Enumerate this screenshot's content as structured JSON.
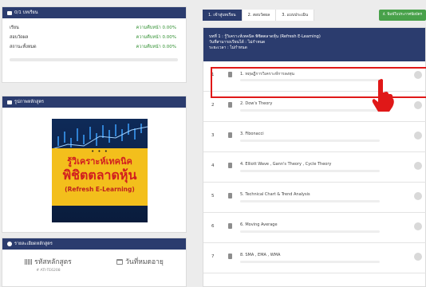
{
  "progress": {
    "header": "0/1 บทเรียน",
    "rows": [
      {
        "label": "เรียน",
        "value": "ความคืบหน้า 0.00%"
      },
      {
        "label": "สอบวัดผล",
        "value": "ความคืบหน้า 0.00%"
      },
      {
        "label": "สถานะทั้งหมด",
        "value": "ความคืบหน้า 0.00%"
      }
    ],
    "overall_fraction": 0.0
  },
  "cover": {
    "header": "รูปภาพหลักสูตร",
    "line1": "รู้วิเคราะห์เทคนิค",
    "line2": "พิชิตตลาดหุ้น",
    "line3": "(Refresh E-Learning)",
    "dots": "• • •"
  },
  "details": {
    "header": "รายละเอียดหลักสูตร",
    "code_label": "รหัสหลักสูตร",
    "code_value": "# ATI-TE6208",
    "expiry_label": "วันที่หมดอายุ"
  },
  "tabs": [
    {
      "label": "1. เข้าสู่บทเรียน",
      "active": true
    },
    {
      "label": "2. สอบวัดผล",
      "active": false
    },
    {
      "label": "3. แบบประเมิน",
      "active": false
    }
  ],
  "extra_button": "4. พิมพ์ใบประกาศนียบัตร",
  "course_header": {
    "line1": "บทที่ 1 : รู้วิเคราะห์เทคนิค พิชิตตลาดหุ้น (Refresh E-Learning)",
    "line2": "วันที่สามารถเรียนได้ : ไม่กำหนด",
    "line3": "ระยะเวลา : ไม่กำหนด"
  },
  "lessons": [
    {
      "num": "1",
      "title": "1. ทฤษฎีการวิเคราะห์การลงทุน"
    },
    {
      "num": "2",
      "title": "2. Dow's Theory"
    },
    {
      "num": "3",
      "title": "3. Fibonacci"
    },
    {
      "num": "4",
      "title": "4. Elliott Wave , Gann's Theory , Cycle Theory"
    },
    {
      "num": "5",
      "title": "5. Technical Chart & Trend Analysis"
    },
    {
      "num": "6",
      "title": "6. Moving Average"
    },
    {
      "num": "7",
      "title": "8. SMA , EMA , WMA"
    }
  ],
  "colors": {
    "header_navy": "#2b3c6e",
    "progress_green": "#2f8f2f",
    "highlight_red": "#e01818"
  }
}
